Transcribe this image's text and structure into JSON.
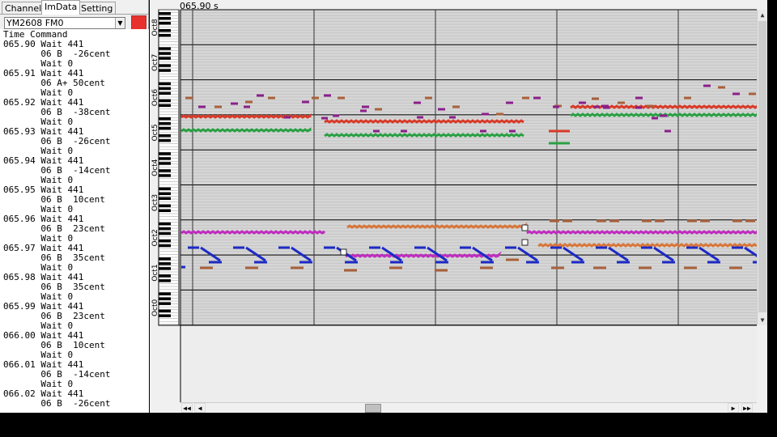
{
  "tabs": [
    {
      "label": "Channel",
      "active": false
    },
    {
      "label": "ImData",
      "active": true
    },
    {
      "label": "Setting",
      "active": false
    }
  ],
  "chip_select": {
    "value": "YM2608 FM0"
  },
  "channel_color": "#e8312c",
  "list": {
    "header": "  Time Command",
    "rows": [
      "065.90 Wait 441",
      "       06 B  -26cent",
      "       Wait 0",
      "065.91 Wait 441",
      "       06 A+ 50cent",
      "       Wait 0",
      "065.92 Wait 441",
      "       06 B  -38cent",
      "       Wait 0",
      "065.93 Wait 441",
      "       06 B  -26cent",
      "       Wait 0",
      "065.94 Wait 441",
      "       06 B  -14cent",
      "       Wait 0",
      "065.95 Wait 441",
      "       06 B  10cent",
      "       Wait 0",
      "065.96 Wait 441",
      "       06 B  23cent",
      "       Wait 0",
      "065.97 Wait 441",
      "       06 B  35cent",
      "       Wait 0",
      "065.98 Wait 441",
      "       06 B  35cent",
      "       Wait 0",
      "065.99 Wait 441",
      "       06 B  23cent",
      "       Wait 0",
      "066.00 Wait 441",
      "       06 B  10cent",
      "       Wait 0",
      "066.01 Wait 441",
      "       06 B  -14cent",
      "       Wait 0",
      "066.02 Wait 441",
      "       06 B  -26cent"
    ]
  },
  "roll": {
    "time_label": "065.90 s",
    "octave_labels": [
      "Oct8",
      "Oct7",
      "Oct6",
      "Oct5",
      "Oct4",
      "Oct3",
      "Oct2",
      "Oct1",
      "Oct0"
    ],
    "track_colors": {
      "red": "#d93a28",
      "green": "#2aa043",
      "purple": "#8a1f8a",
      "brown": "#a8603a",
      "magenta": "#c02cc0",
      "orange": "#d8763a",
      "blue": "#1c2ac4"
    }
  }
}
